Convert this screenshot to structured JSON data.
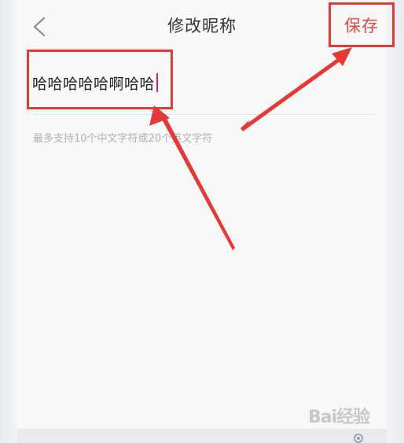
{
  "header": {
    "back_icon": "chevron-left-icon",
    "title": "修改昵称",
    "save_label": "保存"
  },
  "nickname": {
    "value": "哈哈哈哈哈啊哈哈"
  },
  "hint": "最多支持10个中文字符或20个英文字符",
  "watermark": {
    "text": "Bai经验"
  },
  "colors": {
    "accent": "#e8473f",
    "annotation": "#e53935",
    "caret": "#e91e63",
    "background": "#f8f8f9"
  }
}
